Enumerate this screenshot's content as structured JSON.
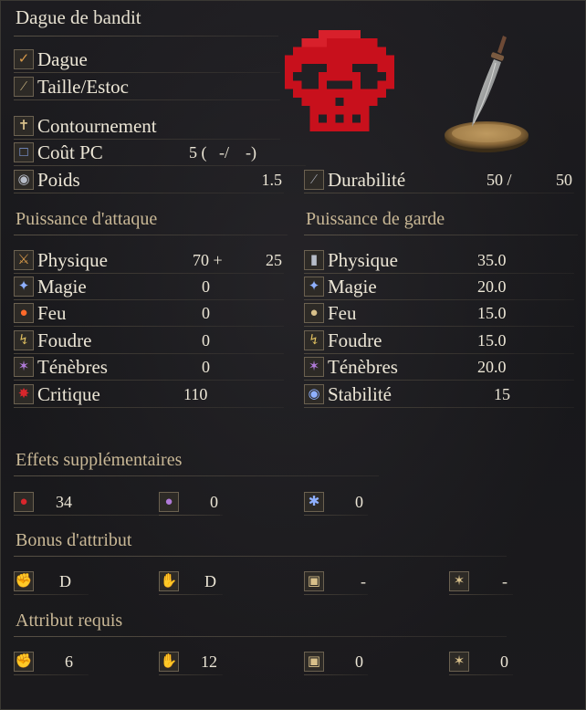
{
  "weapon": {
    "name": "Dague de bandit",
    "type": "Dague",
    "attack_type": "Taille/Estoc",
    "skill": "Contournement",
    "fp_cost_label": "Coût PC",
    "fp_cost_value": "5 (   -/    -)",
    "weight_label": "Poids",
    "weight_value": "1.5",
    "durability_label": "Durabilité",
    "durability_current": "50 /",
    "durability_max": "50"
  },
  "attack": {
    "header": "Puissance d'attaque",
    "rows": [
      {
        "label": "Physique",
        "value": "70 +",
        "bonus": "25",
        "icon": "physical-attack-icon"
      },
      {
        "label": "Magie",
        "value": "0",
        "bonus": "",
        "icon": "magic-attack-icon"
      },
      {
        "label": "Feu",
        "value": "0",
        "bonus": "",
        "icon": "fire-attack-icon"
      },
      {
        "label": "Foudre",
        "value": "0",
        "bonus": "",
        "icon": "lightning-attack-icon"
      },
      {
        "label": "Ténèbres",
        "value": "0",
        "bonus": "",
        "icon": "dark-attack-icon"
      },
      {
        "label": "Critique",
        "value": "110",
        "bonus": "",
        "icon": "critical-attack-icon"
      }
    ]
  },
  "guard": {
    "header": "Puissance de garde",
    "rows": [
      {
        "label": "Physique",
        "value": "35.0",
        "icon": "physical-guard-icon"
      },
      {
        "label": "Magie",
        "value": "20.0",
        "icon": "magic-guard-icon"
      },
      {
        "label": "Feu",
        "value": "15.0",
        "icon": "fire-guard-icon"
      },
      {
        "label": "Foudre",
        "value": "15.0",
        "icon": "lightning-guard-icon"
      },
      {
        "label": "Ténèbres",
        "value": "20.0",
        "icon": "dark-guard-icon"
      },
      {
        "label": "Stabilité",
        "value": "15",
        "icon": "stability-icon"
      }
    ]
  },
  "effects": {
    "header": "Effets supplémentaires",
    "items": [
      {
        "icon": "bleed-icon",
        "value": "34"
      },
      {
        "icon": "poison-icon",
        "value": "0"
      },
      {
        "icon": "frost-icon",
        "value": "0"
      }
    ]
  },
  "scaling": {
    "header": "Bonus d'attribut",
    "items": [
      {
        "icon": "strength-icon",
        "value": "D"
      },
      {
        "icon": "dexterity-icon",
        "value": "D"
      },
      {
        "icon": "intelligence-icon",
        "value": "-"
      },
      {
        "icon": "faith-icon",
        "value": "-"
      }
    ]
  },
  "requirements": {
    "header": "Attribut requis",
    "items": [
      {
        "icon": "strength-icon",
        "value": "6"
      },
      {
        "icon": "dexterity-icon",
        "value": "12"
      },
      {
        "icon": "intelligence-icon",
        "value": "0"
      },
      {
        "icon": "faith-icon",
        "value": "0"
      }
    ]
  },
  "colors": {
    "accent_header": "#c9b896",
    "text": "#ece6d6",
    "skull": "#c8101c",
    "background": "#17171a"
  }
}
